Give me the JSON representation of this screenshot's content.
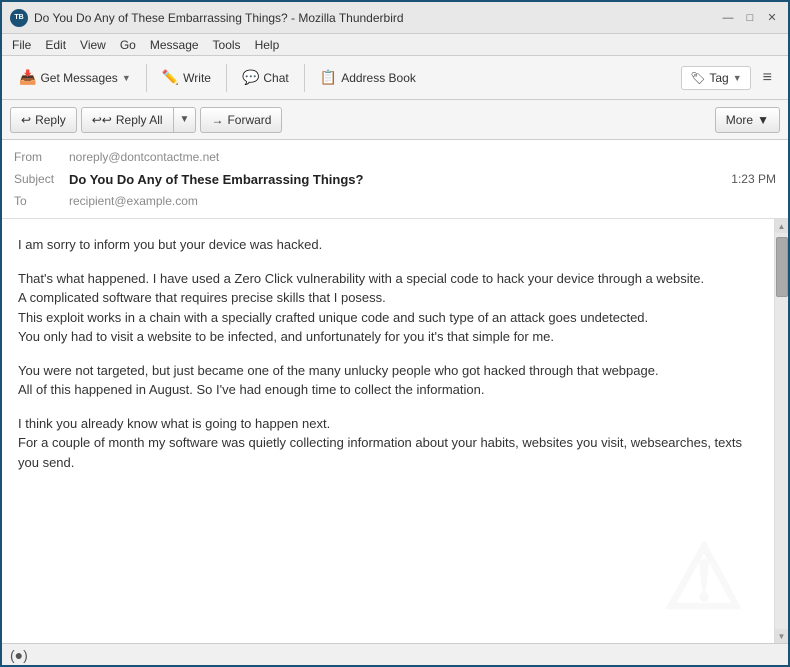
{
  "window": {
    "title": "Do You Do Any of These Embarrassing Things? - Mozilla Thunderbird",
    "icon": "TB"
  },
  "title_controls": {
    "minimize": "—",
    "maximize": "□",
    "close": "✕"
  },
  "menu": {
    "items": [
      "File",
      "Edit",
      "View",
      "Go",
      "Message",
      "Tools",
      "Help"
    ]
  },
  "toolbar": {
    "get_messages": "Get Messages",
    "write": "Write",
    "chat": "Chat",
    "address_book": "Address Book",
    "tag": "Tag",
    "hamburger": "≡"
  },
  "action_toolbar": {
    "reply": "Reply",
    "reply_all": "Reply All",
    "forward": "Forward",
    "more": "More"
  },
  "email": {
    "from_label": "From",
    "from_value": "noreply@dontcontactme.net",
    "subject_label": "Subject",
    "subject_value": "Do You Do Any of These Embarrassing Things?",
    "timestamp": "1:23 PM",
    "to_label": "To",
    "to_value": "recipient@example.com",
    "body": [
      "I am sorry to inform you but your device was hacked.",
      "That's what happened. I have used a Zero Click vulnerability with a special code to hack your device through a website.\nA complicated software that requires precise skills that I posess.\nThis exploit works in a chain with a specially crafted unique code and such type of an attack goes undetected.\nYou only had to visit a website to be infected, and unfortunately for you it's that simple for me.",
      "You were not targeted, but just became one of the many unlucky people who got hacked through that webpage.\nAll of this happened in August. So I've had enough time to collect the information.",
      "I think you already know what is going to happen next.\nFor a couple of month my software was quietly collecting information about your habits, websites you visit, websearches, texts you send."
    ]
  },
  "status_bar": {
    "icon": "📶"
  }
}
